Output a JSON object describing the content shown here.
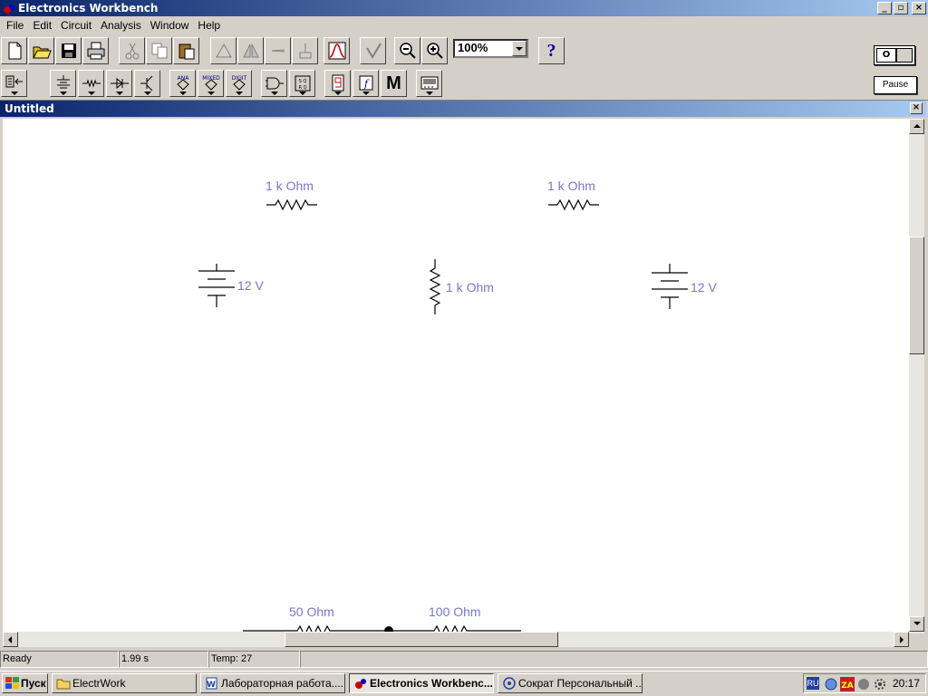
{
  "app": {
    "title": "Electronics Workbench"
  },
  "window_buttons": {
    "minimize": "_",
    "maximize": "▫",
    "close": "×"
  },
  "menu": [
    "File",
    "Edit",
    "Circuit",
    "Analysis",
    "Window",
    "Help"
  ],
  "toolbar": {
    "zoom": "100%",
    "help": "?",
    "power_label": "O",
    "pause_label": "Pause"
  },
  "parts_bin": {
    "analog_ic": "ANA",
    "mixed_ic": "MIXED",
    "digital_ic": "DIGIT",
    "misc": "M"
  },
  "document": {
    "title": "Untitled",
    "close": "×"
  },
  "circuit": {
    "components": [
      {
        "type": "resistor",
        "label": "1 k Ohm"
      },
      {
        "type": "resistor",
        "label": "1 k Ohm"
      },
      {
        "type": "resistor",
        "label": "1 k Ohm"
      },
      {
        "type": "battery",
        "label": "12 V"
      },
      {
        "type": "battery",
        "label": "12 V"
      },
      {
        "type": "resistor",
        "label": "50  Ohm"
      },
      {
        "type": "resistor",
        "label": "100  Ohm"
      }
    ]
  },
  "status": {
    "state": "Ready",
    "time": "1.99 s",
    "temp": "Temp:  27"
  },
  "taskbar": {
    "start": "Пуск",
    "tasks": [
      {
        "label": "ElectrWork"
      },
      {
        "label": "Лабораторная работа...."
      },
      {
        "label": "Electronics Workbenc..."
      },
      {
        "label": "Сократ Персональный ..."
      }
    ],
    "tray_lang": "RU",
    "clock": "20:17"
  }
}
